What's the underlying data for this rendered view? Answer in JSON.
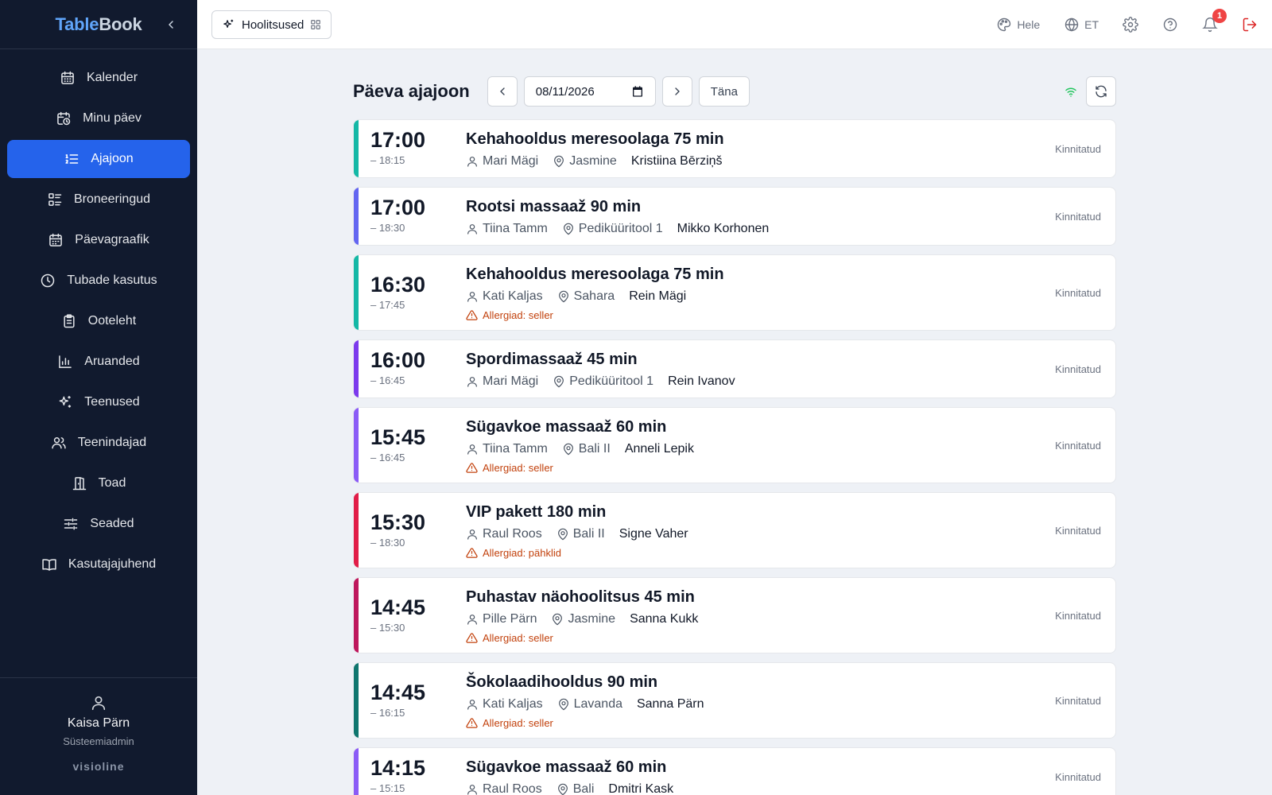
{
  "brand": {
    "part1": "Table",
    "part2": "Book"
  },
  "sidebar": {
    "items": [
      {
        "label": "Kalender"
      },
      {
        "label": "Minu päev"
      },
      {
        "label": "Ajajoon"
      },
      {
        "label": "Broneeringud"
      },
      {
        "label": "Päevagraafik"
      },
      {
        "label": "Tubade kasutus"
      },
      {
        "label": "Ooteleht"
      },
      {
        "label": "Aruanded"
      },
      {
        "label": "Teenused"
      },
      {
        "label": "Teenindajad"
      },
      {
        "label": "Toad"
      },
      {
        "label": "Seaded"
      },
      {
        "label": "Kasutajajuhend"
      }
    ],
    "active_index": 2,
    "user": {
      "name": "Kaisa Pärn",
      "role": "Süsteemiadmin"
    },
    "footer_brand": "visioline"
  },
  "topbar": {
    "module_label": "Hoolitsused",
    "theme_label": "Hele",
    "lang_label": "ET",
    "notification_count": "1"
  },
  "timeline": {
    "title": "Päeva ajajoon",
    "date_value": "08/11/2026",
    "today_label": "Täna",
    "appointments": [
      {
        "start": "17:00",
        "end": "– 18:15",
        "service": "Kehahooldus meresoolaga 75 min",
        "staff": "Mari Mägi",
        "room": "Jasmine",
        "client": "Kristiina Bērziņš",
        "allergy": "",
        "status": "Kinnitatud",
        "color": "#14b8a6"
      },
      {
        "start": "17:00",
        "end": "– 18:30",
        "service": "Rootsi massaaž 90 min",
        "staff": "Tiina Tamm",
        "room": "Pediküüritool 1",
        "client": "Mikko Korhonen",
        "allergy": "",
        "status": "Kinnitatud",
        "color": "#6366f1"
      },
      {
        "start": "16:30",
        "end": "– 17:45",
        "service": "Kehahooldus meresoolaga 75 min",
        "staff": "Kati Kaljas",
        "room": "Sahara",
        "client": "Rein Mägi",
        "allergy": "Allergiad: seller",
        "status": "Kinnitatud",
        "color": "#14b8a6"
      },
      {
        "start": "16:00",
        "end": "– 16:45",
        "service": "Spordimassaaž 45 min",
        "staff": "Mari Mägi",
        "room": "Pediküüritool 1",
        "client": "Rein Ivanov",
        "allergy": "",
        "status": "Kinnitatud",
        "color": "#7c3aed"
      },
      {
        "start": "15:45",
        "end": "– 16:45",
        "service": "Sügavkoe massaaž 60 min",
        "staff": "Tiina Tamm",
        "room": "Bali II",
        "client": "Anneli Lepik",
        "allergy": "Allergiad: seller",
        "status": "Kinnitatud",
        "color": "#8b5cf6"
      },
      {
        "start": "15:30",
        "end": "– 18:30",
        "service": "VIP pakett 180 min",
        "staff": "Raul Roos",
        "room": "Bali II",
        "client": "Signe Vaher",
        "allergy": "Allergiad: pähklid",
        "status": "Kinnitatud",
        "color": "#e11d48"
      },
      {
        "start": "14:45",
        "end": "– 15:30",
        "service": "Puhastav näohoolitsus 45 min",
        "staff": "Pille Pärn",
        "room": "Jasmine",
        "client": "Sanna Kukk",
        "allergy": "Allergiad: seller",
        "status": "Kinnitatud",
        "color": "#be185d"
      },
      {
        "start": "14:45",
        "end": "– 16:15",
        "service": "Šokolaadihooldus 90 min",
        "staff": "Kati Kaljas",
        "room": "Lavanda",
        "client": "Sanna Pärn",
        "allergy": "Allergiad: seller",
        "status": "Kinnitatud",
        "color": "#0f766e"
      },
      {
        "start": "14:15",
        "end": "– 15:15",
        "service": "Sügavkoe massaaž 60 min",
        "staff": "Raul Roos",
        "room": "Bali",
        "client": "Dmitri Kask",
        "allergy": "",
        "status": "Kinnitatud",
        "color": "#8b5cf6"
      }
    ]
  }
}
